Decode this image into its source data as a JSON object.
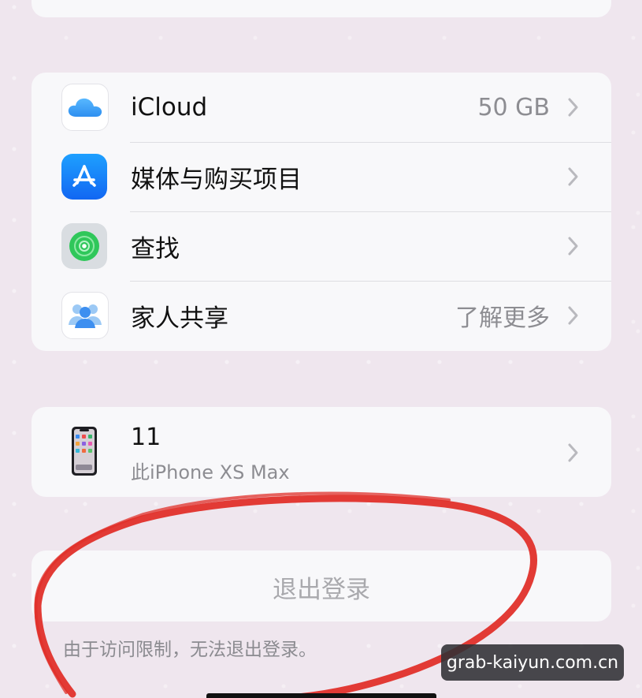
{
  "services": [
    {
      "label": "iCloud",
      "value": "50 GB",
      "icon": "icloud-icon"
    },
    {
      "label": "媒体与购买项目",
      "value": "",
      "icon": "app-store-icon"
    },
    {
      "label": "查找",
      "value": "",
      "icon": "find-my-icon"
    },
    {
      "label": "家人共享",
      "value": "了解更多",
      "icon": "family-sharing-icon"
    }
  ],
  "device": {
    "name": "11",
    "model": "此iPhone XS Max",
    "icon": "iphone-icon"
  },
  "sign_out": {
    "label": "退出登录"
  },
  "footer": {
    "note": "由于访问限制，无法退出登录。"
  },
  "watermark": {
    "text": "grab-kaiyun.com.cn"
  },
  "colors": {
    "background": "#efe6ee",
    "card": "#f8f8fa",
    "secondary_text": "#8d8d92",
    "disabled_text": "#a9a9ad",
    "annotation": "#e0302a"
  }
}
